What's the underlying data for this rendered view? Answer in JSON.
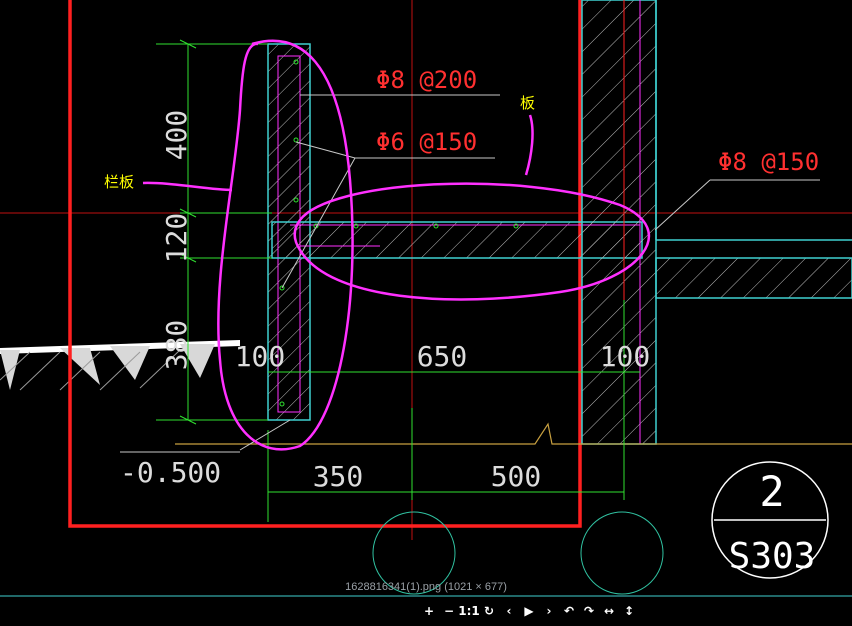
{
  "annotations": {
    "rebar_top": "Φ8 @200",
    "rebar_mid": "Φ6 @150",
    "rebar_right": "Φ8 @150",
    "label_slab": "板",
    "label_parapet": "栏板"
  },
  "dimensions": {
    "vertical": [
      "400",
      "120",
      "380"
    ],
    "horizontal_top": [
      "100",
      "650",
      "100"
    ],
    "horizontal_bottom": [
      "350",
      "500"
    ],
    "elevation": "-0.500"
  },
  "section_marker": {
    "number": "2",
    "sheet": "S303"
  },
  "viewer": {
    "caption": "1628816341(1).png (1021 × 677)",
    "toolbar": [
      {
        "name": "zoom-in-button",
        "glyph": "+"
      },
      {
        "name": "zoom-out-button",
        "glyph": "−"
      },
      {
        "name": "actual-size-button",
        "glyph": "1:1"
      },
      {
        "name": "refresh-button",
        "glyph": "↻"
      },
      {
        "name": "previous-button",
        "glyph": "‹"
      },
      {
        "name": "play-button",
        "glyph": "▶"
      },
      {
        "name": "next-button",
        "glyph": "›"
      },
      {
        "name": "rotate-left-button",
        "glyph": "↶"
      },
      {
        "name": "rotate-right-button",
        "glyph": "↷"
      },
      {
        "name": "fit-width-button",
        "glyph": "↔"
      },
      {
        "name": "fit-height-button",
        "glyph": "↕"
      }
    ]
  },
  "colors": {
    "background": "#000000",
    "red_outline": "#ff2020",
    "cyan": "#3fd0d0",
    "green": "#30e030",
    "magenta": "#ff30ff",
    "yellow": "#ffff00",
    "white": "#ffffff",
    "hatch": "#c8c8c8"
  }
}
